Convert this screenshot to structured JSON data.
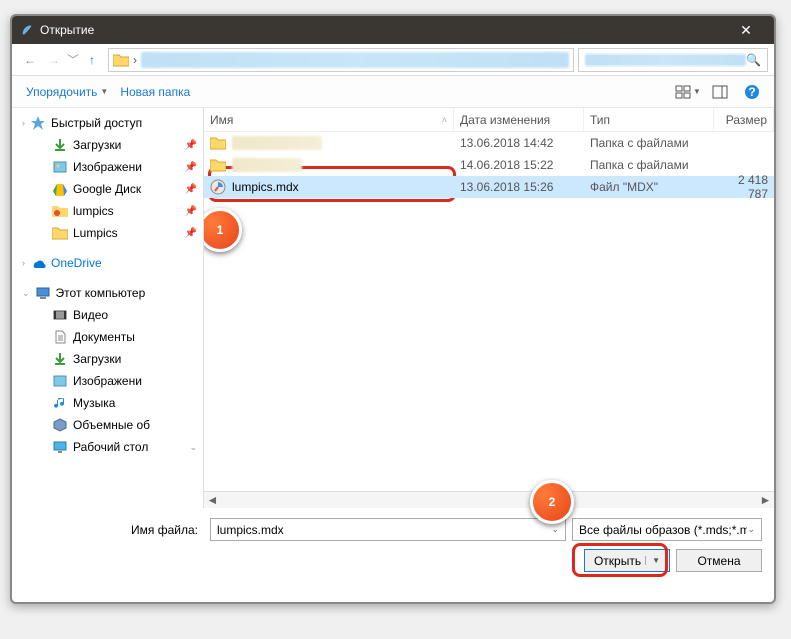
{
  "window": {
    "title": "Открытие"
  },
  "search": {
    "placeholder": "Поиск"
  },
  "toolbar": {
    "organize": "Упорядочить",
    "newfolder": "Новая папка"
  },
  "columns": {
    "name": "Имя",
    "date": "Дата изменения",
    "type": "Тип",
    "size": "Размер"
  },
  "sidebar": {
    "quick": "Быстрый доступ",
    "downloads": "Загрузки",
    "images": "Изображени",
    "gdrive": "Google Диск",
    "lumpics1": "lumpics",
    "lumpics2": "Lumpics",
    "onedrive": "OneDrive",
    "thispc": "Этот компьютер",
    "video": "Видео",
    "documents": "Документы",
    "downloads2": "Загрузки",
    "images2": "Изображени",
    "music": "Музыка",
    "volumes": "Объемные об",
    "desktop": "Рабочий стол"
  },
  "rows": [
    {
      "name": "",
      "date": "13.06.2018 14:42",
      "type": "Папка с файлами",
      "size": ""
    },
    {
      "name": "",
      "date": "14.06.2018 15:22",
      "type": "Папка с файлами",
      "size": ""
    },
    {
      "name": "lumpics.mdx",
      "date": "13.06.2018 15:26",
      "type": "Файл \"MDX\"",
      "size": "2 418 787"
    }
  ],
  "footer": {
    "filename_label": "Имя файла:",
    "filename_value": "lumpics.mdx",
    "filter": "Все файлы образов (*.mds;*.md",
    "open": "Открыть",
    "cancel": "Отмена"
  },
  "badges": {
    "one": "1",
    "two": "2"
  }
}
